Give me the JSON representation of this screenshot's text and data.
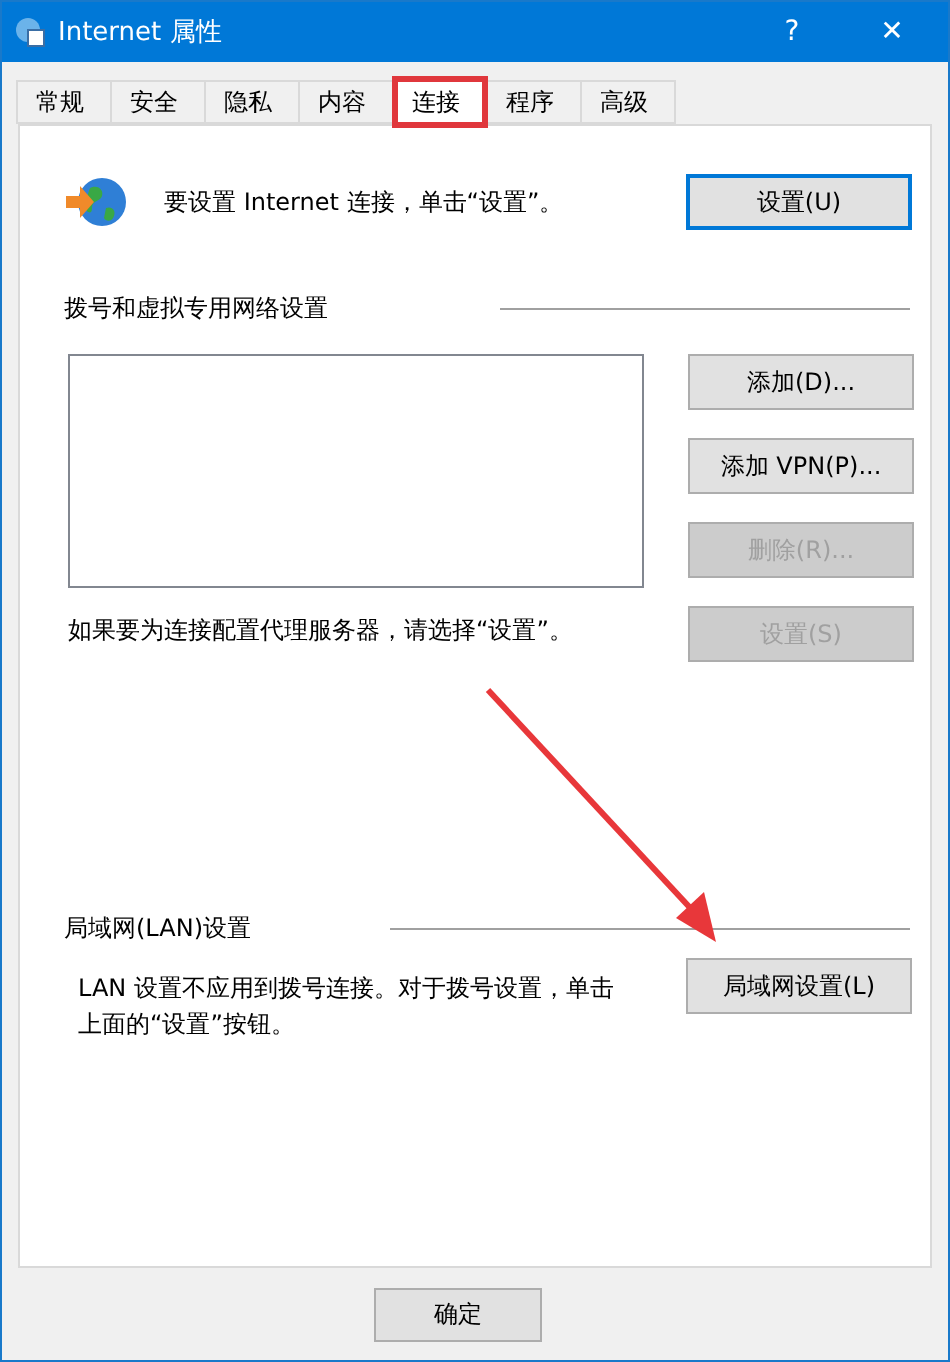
{
  "window": {
    "title": "Internet 属性",
    "help": "?",
    "close": "✕"
  },
  "tabs": [
    {
      "label": "常规",
      "selected": false,
      "highlighted": false
    },
    {
      "label": "安全",
      "selected": false,
      "highlighted": false
    },
    {
      "label": "隐私",
      "selected": false,
      "highlighted": false
    },
    {
      "label": "内容",
      "selected": false,
      "highlighted": false
    },
    {
      "label": "连接",
      "selected": true,
      "highlighted": true
    },
    {
      "label": "程序",
      "selected": false,
      "highlighted": false
    },
    {
      "label": "高级",
      "selected": false,
      "highlighted": false
    }
  ],
  "setup": {
    "text": "要设置 Internet 连接，单击“设置”。",
    "button": {
      "label": "设置(U)",
      "disabled": false,
      "default": true
    }
  },
  "dialup": {
    "heading": "拨号和虚拟专用网络设置",
    "buttons": [
      {
        "label": "添加(D)...",
        "disabled": false
      },
      {
        "label": "添加 VPN(P)...",
        "disabled": false
      },
      {
        "label": "删除(R)...",
        "disabled": true
      }
    ],
    "proxy_text": "如果要为连接配置代理服务器，请选择“设置”。",
    "proxy_button": {
      "label": "设置(S)",
      "disabled": true
    }
  },
  "lan": {
    "heading": "局域网(LAN)设置",
    "text": "LAN 设置不应用到拨号连接。对于拨号设置，单击上面的“设置”按钮。",
    "button": {
      "label": "局域网设置(L)",
      "disabled": false
    }
  },
  "footer": {
    "buttons": [
      {
        "label": "确定"
      }
    ]
  },
  "annotation": {
    "arrow": true
  }
}
